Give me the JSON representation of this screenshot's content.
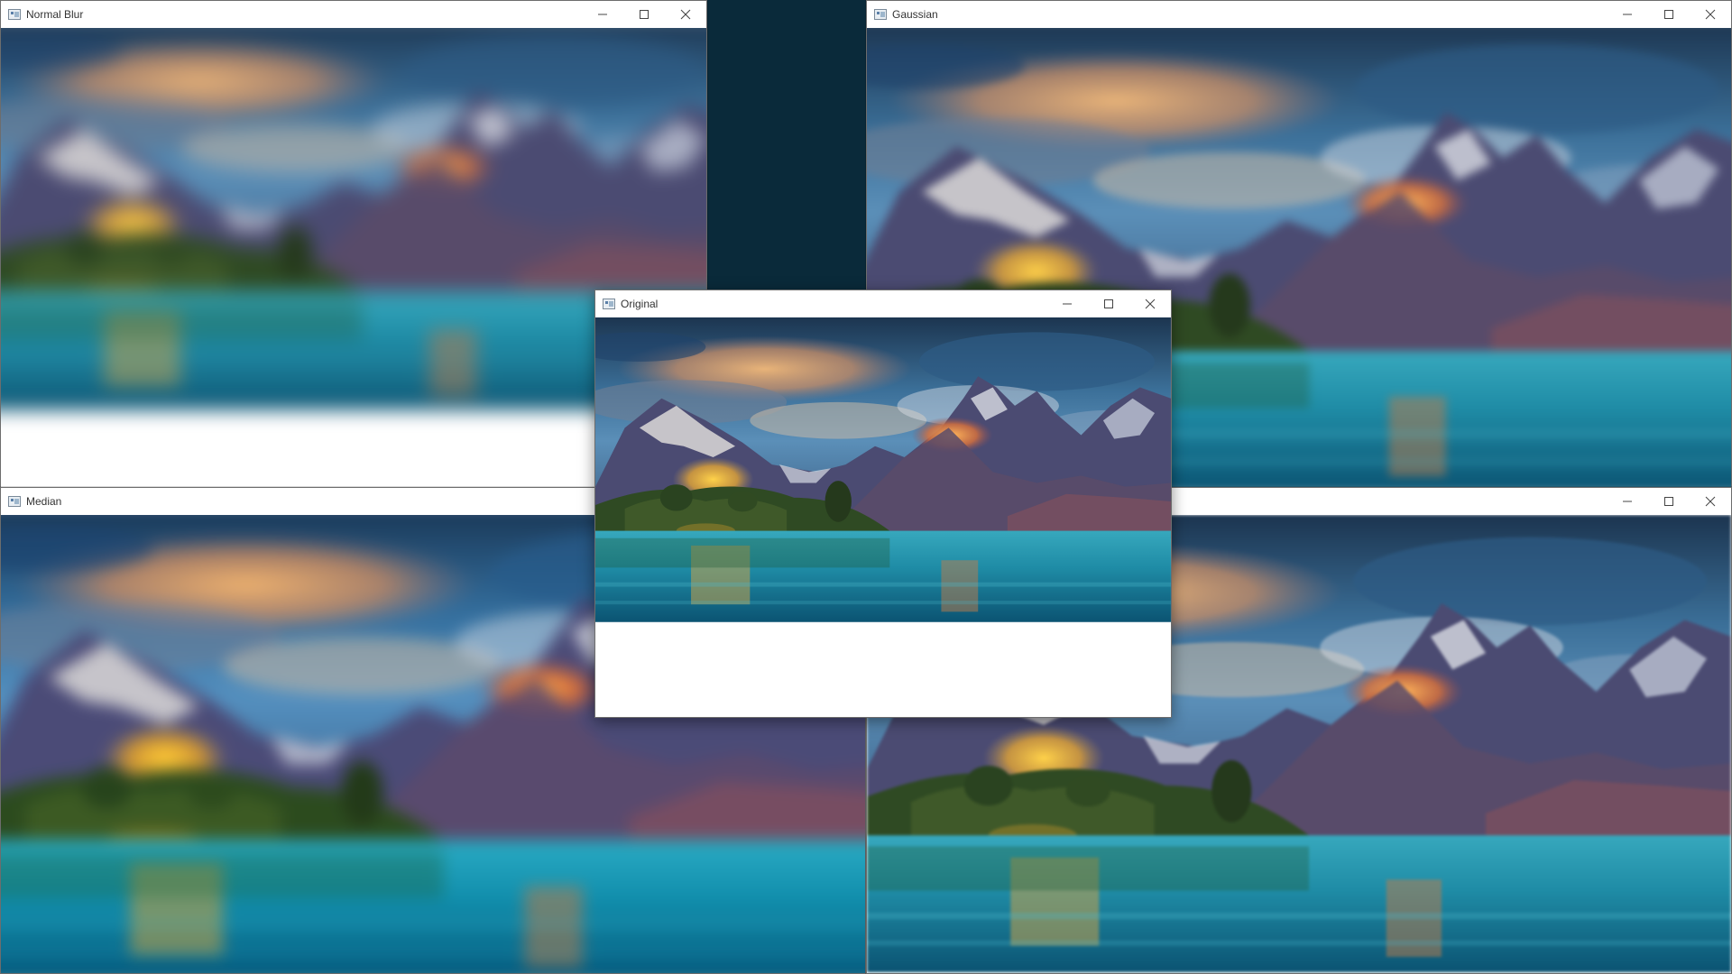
{
  "windows": [
    {
      "key": "normal_blur",
      "title": "Normal Blur"
    },
    {
      "key": "gaussian",
      "title": "Gaussian"
    },
    {
      "key": "median",
      "title": "Median"
    },
    {
      "key": "bilateral",
      "title": ""
    },
    {
      "key": "original",
      "title": "Original"
    }
  ],
  "controls": {
    "minimize_icon": "minimize-icon",
    "maximize_icon": "maximize-icon",
    "close_icon": "close-icon"
  },
  "colors": {
    "sky_top": "#1e3a5a",
    "sky_mid": "#4f7ea8",
    "cloud_warm": "#e7a465",
    "mountain": "#4b4a6e",
    "snow": "#e7e3e0",
    "glow": "#f29a48",
    "foliage": "#2f4a24",
    "lake_top": "#2aa0b8",
    "lake_bottom": "#0d5876"
  }
}
